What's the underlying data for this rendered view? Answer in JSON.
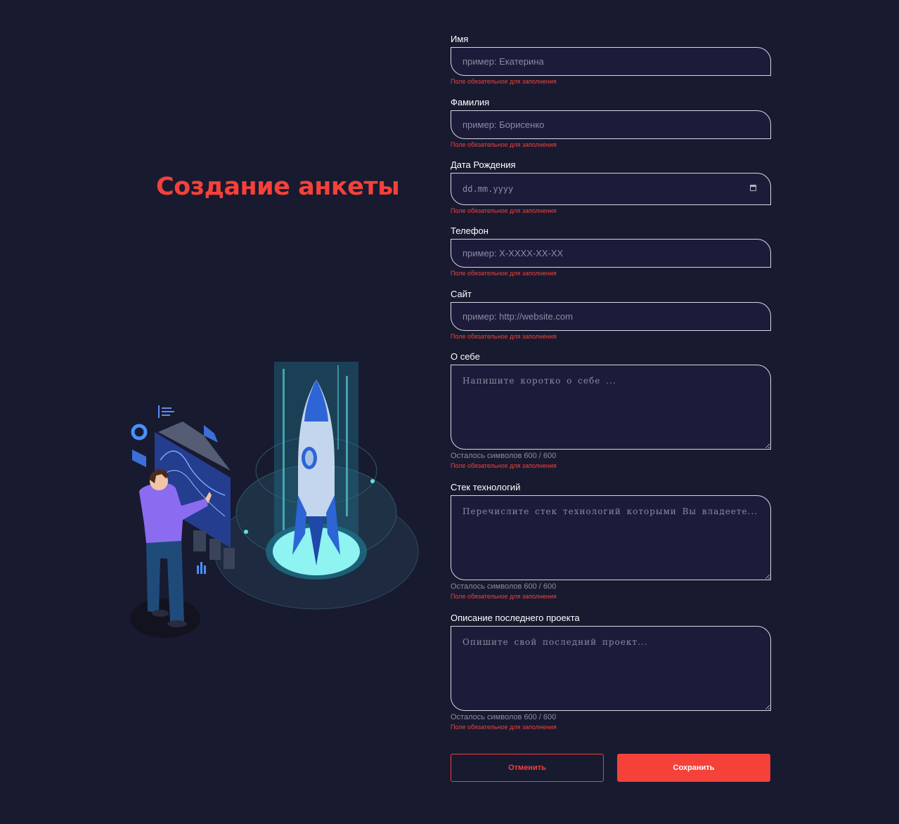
{
  "page": {
    "title": "Создание анкеты"
  },
  "fields": [
    {
      "label": "Имя",
      "placeholder": "пример: Екатерина",
      "error": "Поле обязательное для заполнения"
    },
    {
      "label": "Фамилия",
      "placeholder": "пример: Борисенко",
      "error": "Поле обязательное для заполнения"
    },
    {
      "label": "Дата Рождения",
      "placeholder": "dd.mm.yyyy",
      "error": "Поле обязательное для заполнения"
    },
    {
      "label": "Телефон",
      "placeholder": "пример: X-XXXX-XX-XX",
      "error": "Поле обязательное для заполнения"
    },
    {
      "label": "Сайт",
      "placeholder": "пример: http://website.com",
      "error": "Поле обязательное для заполнения"
    },
    {
      "label": "О себе",
      "placeholder": "Напишите коротко о себе ...",
      "counter": "Осталось символов 600 / 600",
      "error": "Поле обязательное для заполнения"
    },
    {
      "label": "Стек технологий",
      "placeholder": "Перечислите стек технологий которыми Вы владеете...",
      "counter": "Осталось символов 600 / 600",
      "error": "Поле обязательное для заполнения"
    },
    {
      "label": "Описание последнего проекта",
      "placeholder": "Опишите свой последний проект...",
      "counter": "Осталось символов 600 / 600",
      "error": "Поле обязательное для заполнения"
    }
  ],
  "buttons": {
    "cancel": "Отменить",
    "save": "Сохранить"
  },
  "colors": {
    "background": "#181a30",
    "accent": "#f4413a",
    "input_bg": "#1c1c3a",
    "border": "#d7d8e3"
  }
}
